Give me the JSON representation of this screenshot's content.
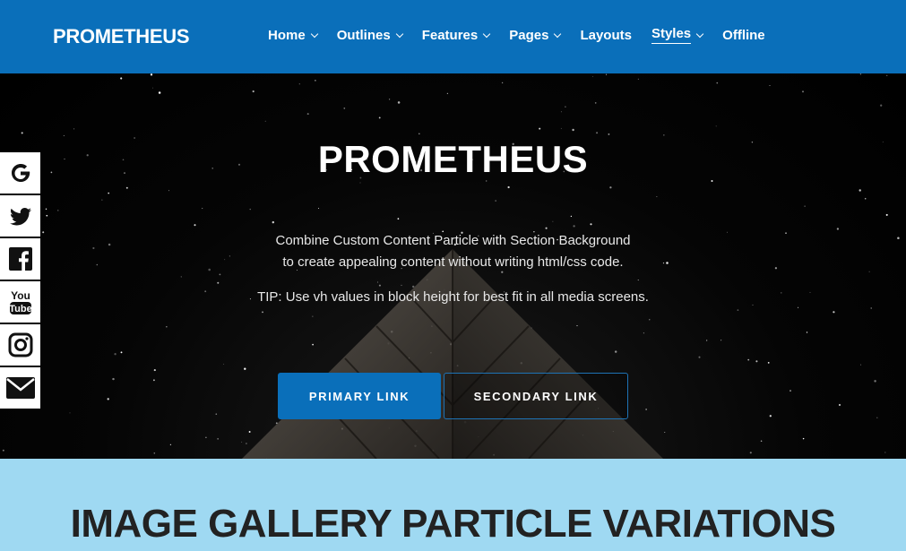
{
  "header": {
    "logo": "PROMETHEUS",
    "nav": [
      {
        "label": "Home",
        "dropdown": true
      },
      {
        "label": "Outlines",
        "dropdown": true
      },
      {
        "label": "Features",
        "dropdown": true
      },
      {
        "label": "Pages",
        "dropdown": true
      },
      {
        "label": "Layouts",
        "dropdown": false
      },
      {
        "label": "Styles",
        "dropdown": true,
        "active": true
      },
      {
        "label": "Offline",
        "dropdown": false
      }
    ]
  },
  "hero": {
    "title": "PROMETHEUS",
    "line1": "Combine Custom Content Particle with Section Background",
    "line2": "to create appealing content without writing html/css code.",
    "tip": "TIP: Use vh values in block height for best fit in all media screens.",
    "primary_button": "PRIMARY LINK",
    "secondary_button": "SECONDARY LINK"
  },
  "social": [
    {
      "icon": "google-icon"
    },
    {
      "icon": "twitter-icon"
    },
    {
      "icon": "facebook-icon"
    },
    {
      "icon": "youtube-icon"
    },
    {
      "icon": "instagram-icon"
    },
    {
      "icon": "email-icon"
    }
  ],
  "section": {
    "title": "IMAGE GALLERY PARTICLE VARIATIONS"
  },
  "colors": {
    "brand_blue": "#0a6fba",
    "light_blue": "#9fd9f2"
  }
}
